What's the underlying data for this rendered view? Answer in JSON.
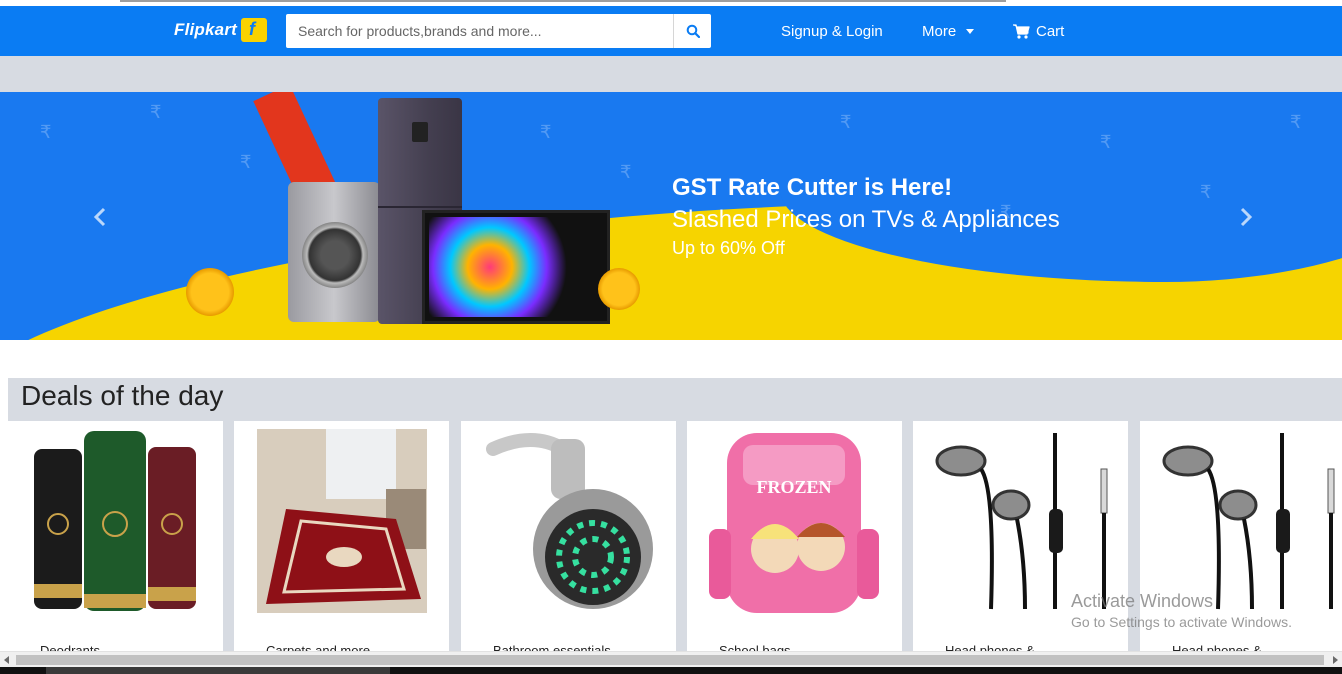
{
  "header": {
    "logo_text": "Flipkart",
    "search_placeholder": "Search for products,brands and more...",
    "nav": {
      "signup": "Signup & Login",
      "more": "More",
      "cart": "Cart"
    }
  },
  "banner": {
    "title": "GST Rate Cutter is Here!",
    "subtitle": "Slashed Prices on TVs & Appliances",
    "offer": "Up to 60% Off"
  },
  "deals": {
    "title": "Deals of the day",
    "cards": [
      {
        "label": "Deodrants"
      },
      {
        "label": "Carpets and more"
      },
      {
        "label": "Bathroom essentials"
      },
      {
        "label": "School bags"
      },
      {
        "label": "Head phones &"
      },
      {
        "label": "Head phones &"
      }
    ]
  },
  "watermark": {
    "line1": "Activate Windows",
    "line2": "Go to Settings to activate Windows."
  },
  "colors": {
    "brand_blue": "#0a7cf3",
    "brand_yellow": "#f9d200",
    "section_grey": "#d7dbe2"
  }
}
